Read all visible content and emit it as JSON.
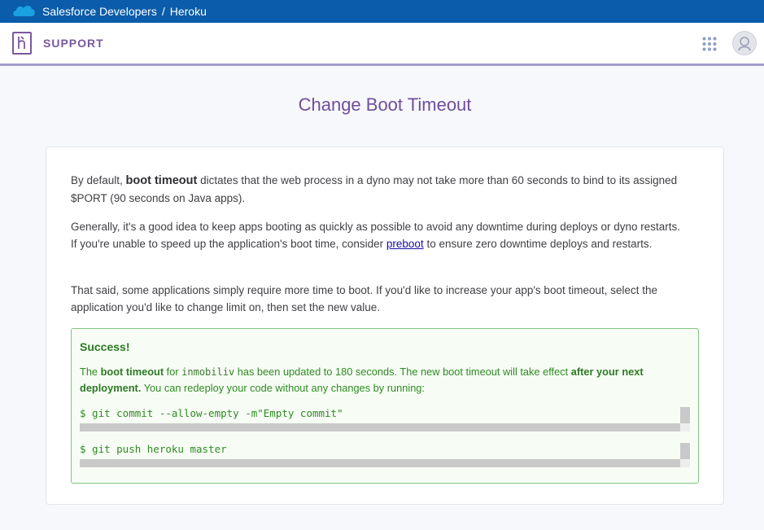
{
  "topbar": {
    "brand": "Salesforce Developers",
    "separator": "/",
    "product": "Heroku"
  },
  "header": {
    "section": "SUPPORT"
  },
  "page": {
    "title": "Change Boot Timeout"
  },
  "content": {
    "p1_before": "By default, ",
    "p1_bold": "boot timeout",
    "p1_after": " dictates that the web process in a dyno may not take more than 60 seconds to bind to its assigned $PORT (90 seconds on Java apps).",
    "p2_before": "Generally, it's a good idea to keep apps booting as quickly as possible to avoid any downtime during deploys or dyno restarts. If you're unable to speed up the application's boot time, consider ",
    "p2_link": "preboot",
    "p2_after": " to ensure zero downtime deploys and restarts.",
    "p3": "That said, some applications simply require more time to boot. If you'd like to increase your app's boot timeout, select the application you'd like to change limit on, then set the new value."
  },
  "success": {
    "title": "Success!",
    "msg_the": "The ",
    "msg_bold1": "boot timeout",
    "msg_for": " for ",
    "app_name": "inmobiliv",
    "msg_mid": " has been updated to 180 seconds. The new boot timeout will take effect ",
    "msg_bold2": "after your next deployment.",
    "msg_end": " You can redeploy your code without any changes by running:",
    "cmd1": "$ git commit --allow-empty -m\"Empty commit\"",
    "cmd2": "$ git push heroku master"
  },
  "colors": {
    "topbar": "#0b5cab",
    "heroku_purple": "#79589f",
    "success_green": "#2e8b22"
  }
}
